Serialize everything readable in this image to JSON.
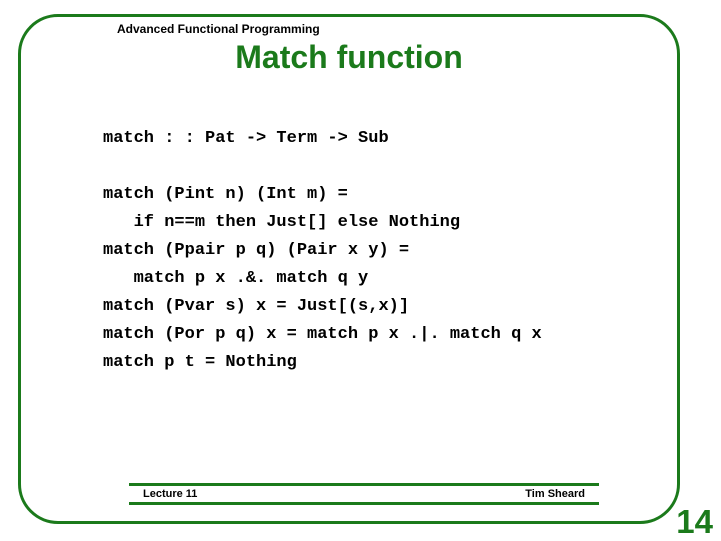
{
  "header": {
    "course": "Advanced Functional Programming"
  },
  "title": "Match function",
  "code": {
    "sig": "match : : Pat -> Term -> Sub",
    "l1": "match (Pint n) (Int m) =",
    "l2": "   if n==m then Just[] else Nothing",
    "l3": "match (Ppair p q) (Pair x y) =",
    "l4": "   match p x .&. match q y",
    "l5": "match (Pvar s) x = Just[(s,x)]",
    "l6": "match (Por p q) x = match p x .|. match q x",
    "l7": "match p t = Nothing"
  },
  "footer": {
    "lecture": "Lecture 11",
    "author": "Tim Sheard"
  },
  "page_number": "14"
}
